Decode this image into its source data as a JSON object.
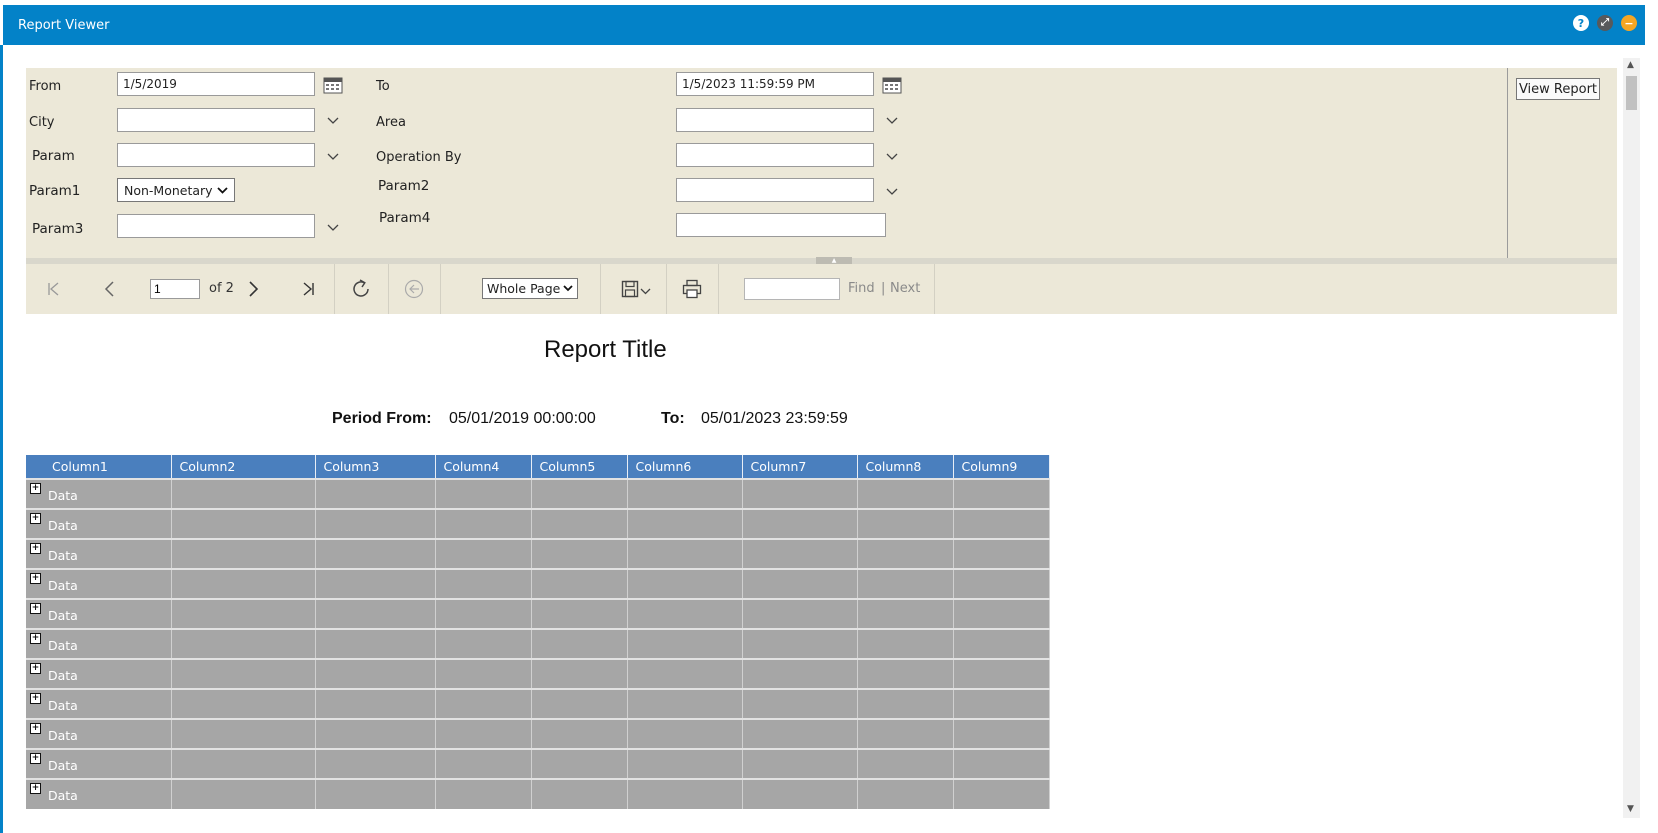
{
  "window": {
    "title": "Report Viewer",
    "icons": [
      "help-icon",
      "expand-icon",
      "minimize-icon"
    ],
    "help_glyph": "?",
    "expand_glyph": "⤢",
    "minimize_glyph": "−"
  },
  "params": {
    "from_label": "From",
    "from_value": "1/5/2019",
    "to_label": "To",
    "to_value": "1/5/2023 11:59:59 PM",
    "city_label": "City",
    "city_value": "",
    "area_label": "Area",
    "area_value": "",
    "param_label": "Param",
    "param_value": "",
    "operation_by_label": "Operation By",
    "operation_by_value": "",
    "param1_label": "Param1",
    "param1_value": "Non-Monetary",
    "param2_label": "Param2",
    "param2_value": "",
    "param3_label": "Param3",
    "param3_value": "",
    "param4_label": "Param4",
    "param4_value": "",
    "view_report_label": "View Report"
  },
  "toolbar": {
    "page_value": "1",
    "page_of": "of 2",
    "zoom_value": "Whole Page",
    "find_value": "",
    "find_label": "Find",
    "separator": "|",
    "next_label": "Next"
  },
  "report": {
    "title": "Report Title",
    "period_from_label": "Period From:",
    "period_from_value": "05/01/2019 00:00:00",
    "period_to_label": "To:",
    "period_to_value": "05/01/2023 23:59:59",
    "columns": [
      "Column1",
      "Column2",
      "Column3",
      "Column4",
      "Column5",
      "Column6",
      "Column7",
      "Column8",
      "Column9"
    ],
    "rows": [
      "Data",
      "Data",
      "Data",
      "Data",
      "Data",
      "Data",
      "Data",
      "Data",
      "Data",
      "Data",
      "Data"
    ]
  },
  "colors": {
    "titlebar": "#0382c8",
    "param_bg": "#ece8d8",
    "table_header": "#4a7fbe",
    "table_cell": "#a6a6a6"
  }
}
